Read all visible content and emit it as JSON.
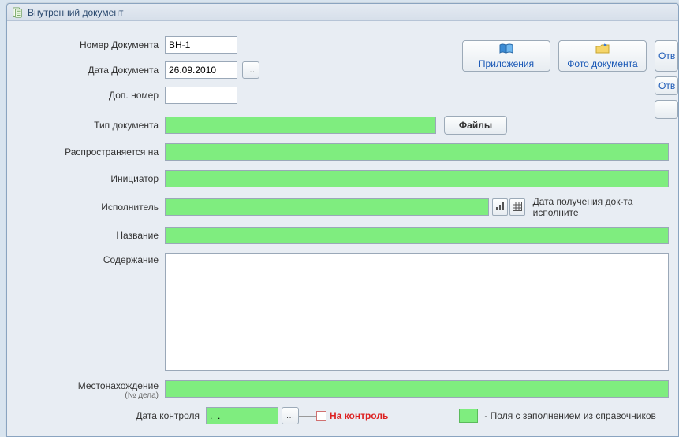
{
  "window": {
    "title": "Внутренний документ"
  },
  "buttons": {
    "attachments": "Приложения",
    "photo_doc": "Фото документа",
    "resp_cut": "Отв",
    "files": "Файлы"
  },
  "labels": {
    "doc_number": "Номер Документа",
    "doc_date": "Дата Документа",
    "extra_number": "Доп. номер",
    "doc_type": "Тип документа",
    "applies_to": "Распространяется на",
    "initiator": "Инициатор",
    "executor": "Исполнитель",
    "name": "Название",
    "content": "Содержание",
    "location": "Местонахождение",
    "location_sub": "(№ дела)",
    "ctl_date": "Дата контроля",
    "on_control": "На контроль",
    "exec_recv_date": "Дата получения док-та исполните"
  },
  "values": {
    "doc_number": "ВН-1",
    "doc_date": "26.09.2010",
    "extra_number": "",
    "doc_type": "",
    "applies_to": "",
    "initiator": "",
    "executor": "",
    "name": "",
    "content": "",
    "location": "",
    "ctl_date": ".  ."
  },
  "legend": {
    "text": "-  Поля с заполнением из справочников"
  }
}
